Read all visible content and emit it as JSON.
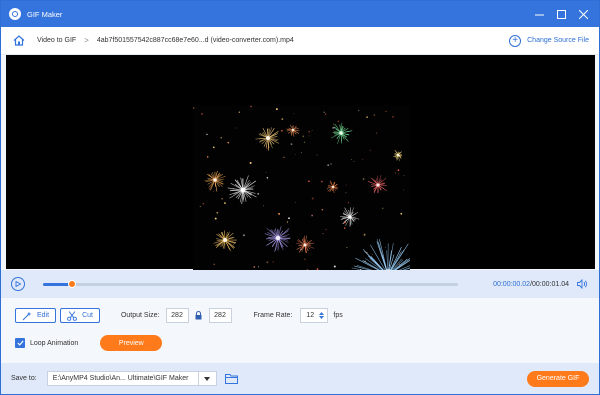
{
  "window": {
    "title": "GIF Maker",
    "icons": {
      "logo": "gif-maker-logo-icon",
      "minimize": "minimize-icon",
      "maximize": "maximize-icon",
      "close": "close-icon"
    }
  },
  "nav": {
    "home_icon": "home-icon",
    "breadcrumb_root": "Video to GIF",
    "separator": ">",
    "file_name": "4ab7f501557542c887cc68e7e60...d (video-converter.com).mp4",
    "change_source_label": "Change Source File",
    "change_source_icon": "plus-circle-icon"
  },
  "player": {
    "current_time": "00:00:00.02",
    "total_time": "/00:00:01.04",
    "progress": 0.07,
    "icons": {
      "play": "play-icon",
      "volume": "volume-icon"
    }
  },
  "controls": {
    "edit_label": "Edit",
    "cut_label": "Cut",
    "output_size_label": "Output Size:",
    "width": "282",
    "height": "282",
    "lock_icon": "lock-icon",
    "frame_rate_label": "Frame Rate:",
    "frame_rate": "12",
    "fps_label": "fps",
    "loop_label": "Loop Animation",
    "loop_checked": true,
    "preview_label": "Preview"
  },
  "footer": {
    "save_to_label": "Save to:",
    "save_path": "E:\\AnyMP4 Studio\\An... Ultimate\\GIF Maker",
    "folder_icon": "folder-icon",
    "generate_label": "Generate GIF"
  },
  "colors": {
    "accent": "#3474dc",
    "orange": "#ff7a1a",
    "bar": "#dfe9f9"
  }
}
